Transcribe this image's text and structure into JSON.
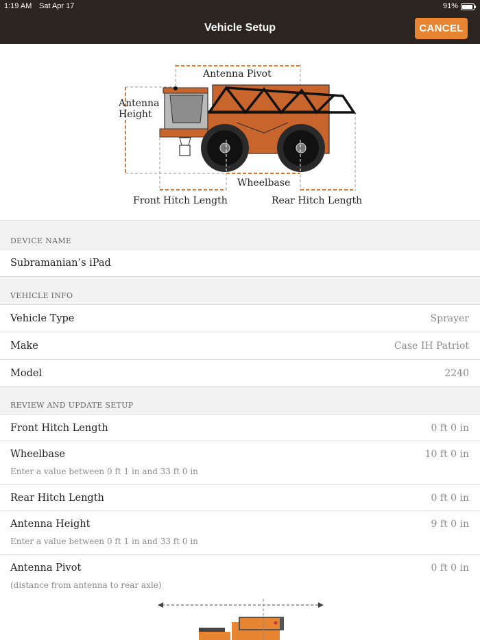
{
  "status_bar": {
    "time": "1:19 AM",
    "date": "Sat Apr 17",
    "battery": "91%"
  },
  "nav": {
    "title": "Vehicle Setup",
    "cancel_label": "CANCEL"
  },
  "diagram": {
    "antenna_pivot": "Antenna Pivot",
    "antenna_height_line1": "Antenna",
    "antenna_height_line2": "Height",
    "wheelbase": "Wheelbase",
    "front_hitch_length": "Front Hitch Length",
    "rear_hitch_length": "Rear Hitch Length"
  },
  "device_section": {
    "header": "DEVICE NAME",
    "device_name": "Subramanian’s iPad"
  },
  "vehicle_section": {
    "header": "VEHICLE INFO",
    "rows": [
      {
        "label": "Vehicle Type",
        "value": "Sprayer"
      },
      {
        "label": "Make",
        "value": "Case IH Patriot"
      },
      {
        "label": "Model",
        "value": "2240"
      }
    ]
  },
  "setup_section": {
    "header": "REVIEW AND UPDATE SETUP",
    "front_hitch": {
      "label": "Front Hitch Length",
      "value": "0 ft 0 in"
    },
    "wheelbase": {
      "label": "Wheelbase",
      "value": "10 ft 0 in",
      "hint": "Enter a value between 0 ft 1 in and 33 ft 0 in"
    },
    "rear_hitch": {
      "label": "Rear Hitch Length",
      "value": "0 ft 0 in"
    },
    "antenna_height": {
      "label": "Antenna Height",
      "value": "9 ft 0 in",
      "hint": "Enter a value between 0 ft 1 in and 33 ft 0 in"
    },
    "antenna_pivot": {
      "label": "Antenna Pivot",
      "value": "0 ft 0 in",
      "hint": "(distance from antenna to rear axle)"
    }
  },
  "colors": {
    "nav_bg": "#2b241f",
    "accent": "#e88532",
    "vehicle_orange": "#c8652d",
    "dimension_line": "#d9782c"
  }
}
